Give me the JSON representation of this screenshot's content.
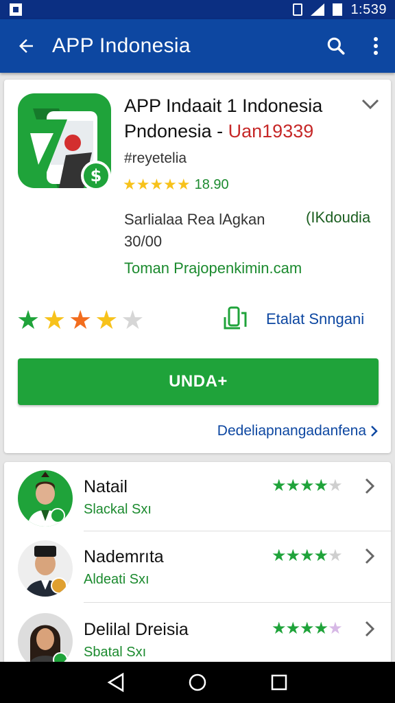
{
  "status_bar": {
    "time": "1:539",
    "icons": [
      "notification-icon",
      "vibrate-icon",
      "signal-icon",
      "battery-icon"
    ]
  },
  "app_bar": {
    "title": "APP Indonesia",
    "back_icon": "arrow-left-icon",
    "search_icon": "search-icon",
    "more_icon": "more-vert-icon",
    "color": "#0d47a1"
  },
  "app": {
    "name_line1": "APP Indaait 1 Indonesia",
    "name_line2": "Pndonesia -",
    "name_line2_price": "Uan19339",
    "category": "#reyetelia",
    "rating_stars": "★★★★★",
    "rating_value": "18.90",
    "info_line1": "Sarlialaa Rea lAgkan",
    "info_line2": "30/00",
    "info_right": "(IKdoudia",
    "developer_link": "Toman Prajopenkimin.cam",
    "big_rating": 4,
    "share_label": "Etalat Snngani",
    "install_label": "UNDA+",
    "details_link": "Dedeliapnangadanfena",
    "colors": {
      "accent_green": "#1fa33a",
      "link_blue": "#0d47a1",
      "price_red": "#c62828",
      "star_yellow": "#f7c21b",
      "star_orange": "#f26d1e",
      "star_green": "#1fa33a"
    }
  },
  "list": [
    {
      "name": "Natail",
      "sub": "Slackal Sxı",
      "rating": 4,
      "avatar_bg": "#1fa33a"
    },
    {
      "name": "Nademrıta",
      "sub": "Aldeati Sxı",
      "rating": 3.5,
      "avatar_bg": "#eeeeee"
    },
    {
      "name": "Delilal Dreisia",
      "sub": "Sbatal Sxı",
      "rating": 3.5,
      "avatar_bg": "#dddddd"
    }
  ],
  "nav_bar": {
    "icons": [
      "back-triangle-icon",
      "home-circle-icon",
      "recents-square-icon"
    ]
  }
}
